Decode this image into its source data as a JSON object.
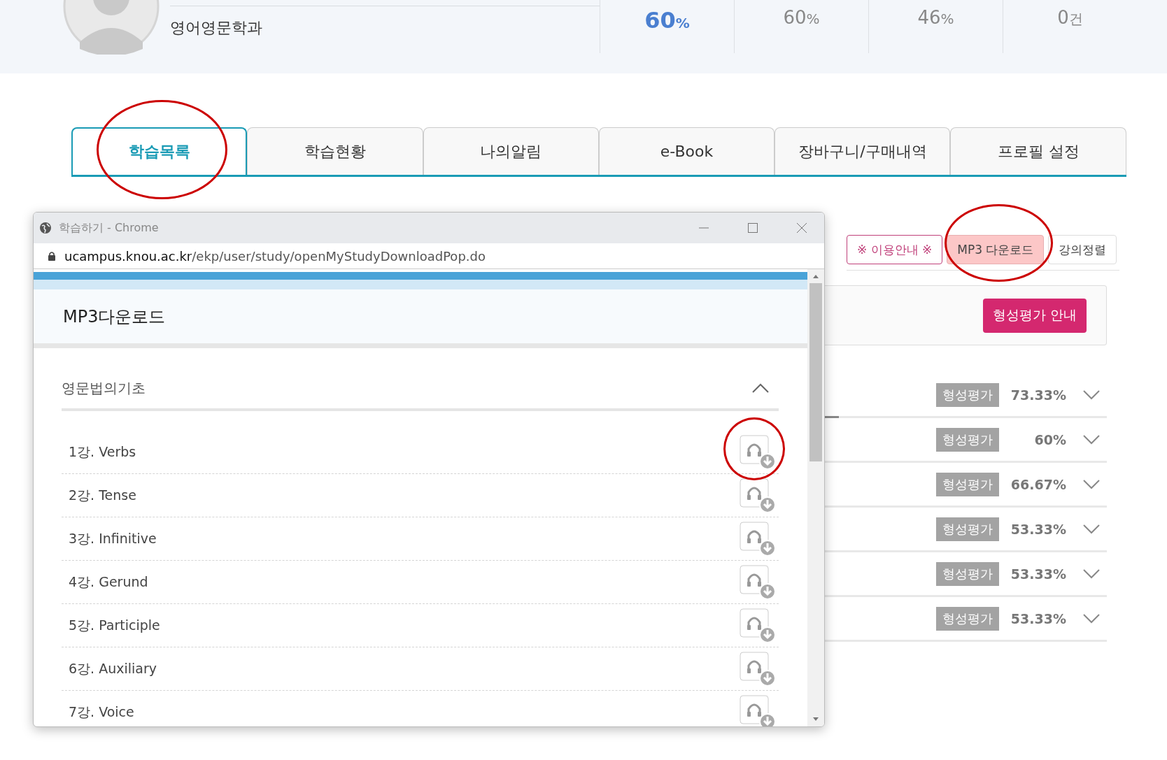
{
  "profile": {
    "department": "영어영문학과"
  },
  "stats": [
    {
      "value": "60",
      "unit": "%",
      "emphasized": true
    },
    {
      "value": "60",
      "unit": "%",
      "emphasized": false
    },
    {
      "value": "46",
      "unit": "%",
      "emphasized": false
    },
    {
      "value": "0",
      "unit": "건",
      "emphasized": false
    }
  ],
  "tabs": [
    {
      "label": "학습목록",
      "selected": true
    },
    {
      "label": "학습현황",
      "selected": false
    },
    {
      "label": "나의알림",
      "selected": false
    },
    {
      "label": "e-Book",
      "selected": false
    },
    {
      "label": "장바구니/구매내역",
      "selected": false
    },
    {
      "label": "프로필 설정",
      "selected": false
    }
  ],
  "toolbar_buttons": [
    {
      "label": "※ 이용안내 ※",
      "kind": "notice"
    },
    {
      "label": "MP3 다운로드",
      "kind": "highlighted"
    },
    {
      "label": "강의정렬",
      "kind": "plain"
    }
  ],
  "guide_button": "형성평가 안내",
  "courses": [
    {
      "badge": "형성평가",
      "score": "73.33%",
      "level": 0.07
    },
    {
      "badge": "형성평가",
      "score": "60%"
    },
    {
      "badge": "형성평가",
      "score": "66.67%"
    },
    {
      "badge": "형성평가",
      "score": "53.33%"
    },
    {
      "badge": "형성평가",
      "score": "53.33%"
    },
    {
      "badge": "형성평가",
      "score": "53.33%"
    }
  ],
  "popup": {
    "title": "학습하기 - Chrome",
    "url_host": "ucampus.knou.ac.kr",
    "url_path": "/ekp/user/study/openMyStudyDownloadPop.do",
    "heading": "MP3다운로드",
    "section": {
      "title": "영문법의기초",
      "expanded": true,
      "lectures": [
        {
          "title": "1강. Verbs"
        },
        {
          "title": "2강. Tense"
        },
        {
          "title": "3강. Infinitive"
        },
        {
          "title": "4강. Gerund"
        },
        {
          "title": "5강. Participle"
        },
        {
          "title": "6강. Auxiliary"
        },
        {
          "title": "7강. Voice"
        }
      ]
    }
  }
}
